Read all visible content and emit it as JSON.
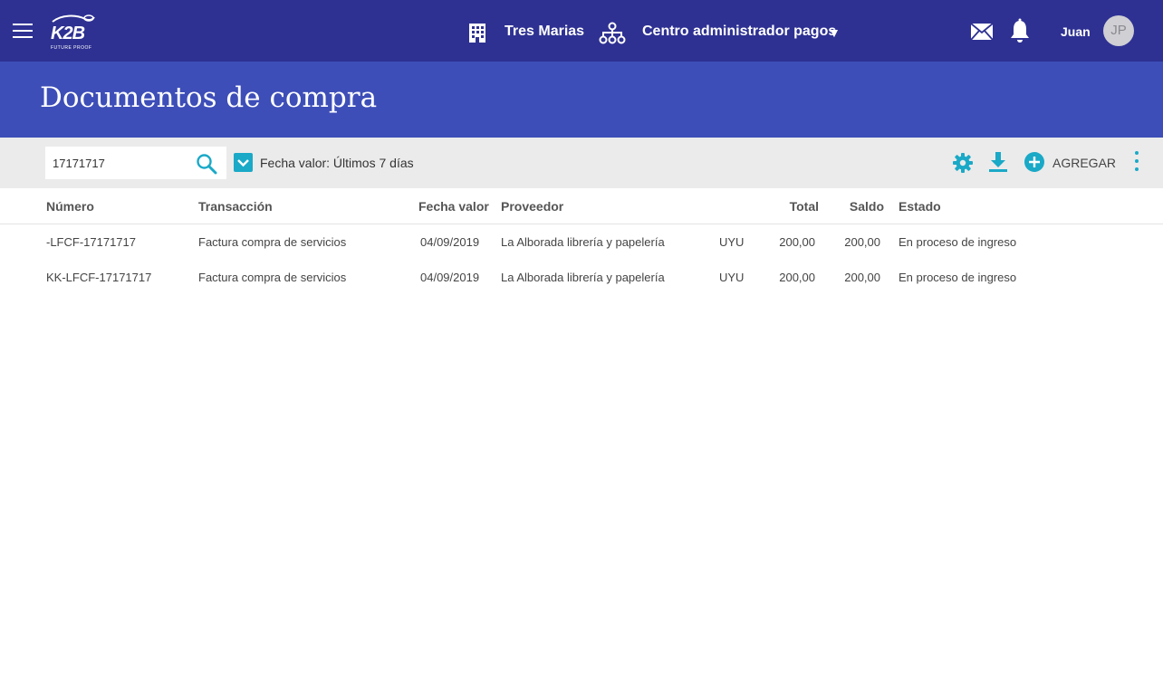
{
  "header": {
    "logo_text": "K2B",
    "logo_tagline": "FUTURE PROOF",
    "company": "Tres Marias",
    "center": "Centro administrador pagos",
    "center_caret": "▼",
    "user": "Juan",
    "avatar_initials": "JP",
    "icons": [
      "menu-icon",
      "building-icon",
      "org-chart-icon",
      "mail-icon",
      "bell-icon"
    ]
  },
  "page": {
    "title": "Documentos de compra"
  },
  "filters": {
    "search_value": "17171717",
    "date_filter_label": "Fecha valor: Últimos 7 días",
    "add_label": "AGREGAR"
  },
  "table": {
    "columns": [
      "Número",
      "Transacción",
      "Fecha valor",
      "Proveedor",
      "Total",
      "Saldo",
      "Estado"
    ],
    "rows": [
      [
        "-LFCF-17171717",
        "Factura compra de servicios",
        "04/09/2019",
        "La Alborada librería y papelería",
        "UYU",
        "200,00",
        "200,00",
        "En proceso de ingreso"
      ],
      [
        "KK-LFCF-17171717",
        "Factura compra de servicios",
        "04/09/2019",
        "La Alborada librería y papelería",
        "UYU",
        "200,00",
        "200,00",
        "En proceso de ingreso"
      ]
    ]
  },
  "colors": {
    "topbar": "#2e3192",
    "title_band": "#3d4eb8",
    "accent": "#1aa9c7",
    "filter_bar": "#ebebeb"
  }
}
